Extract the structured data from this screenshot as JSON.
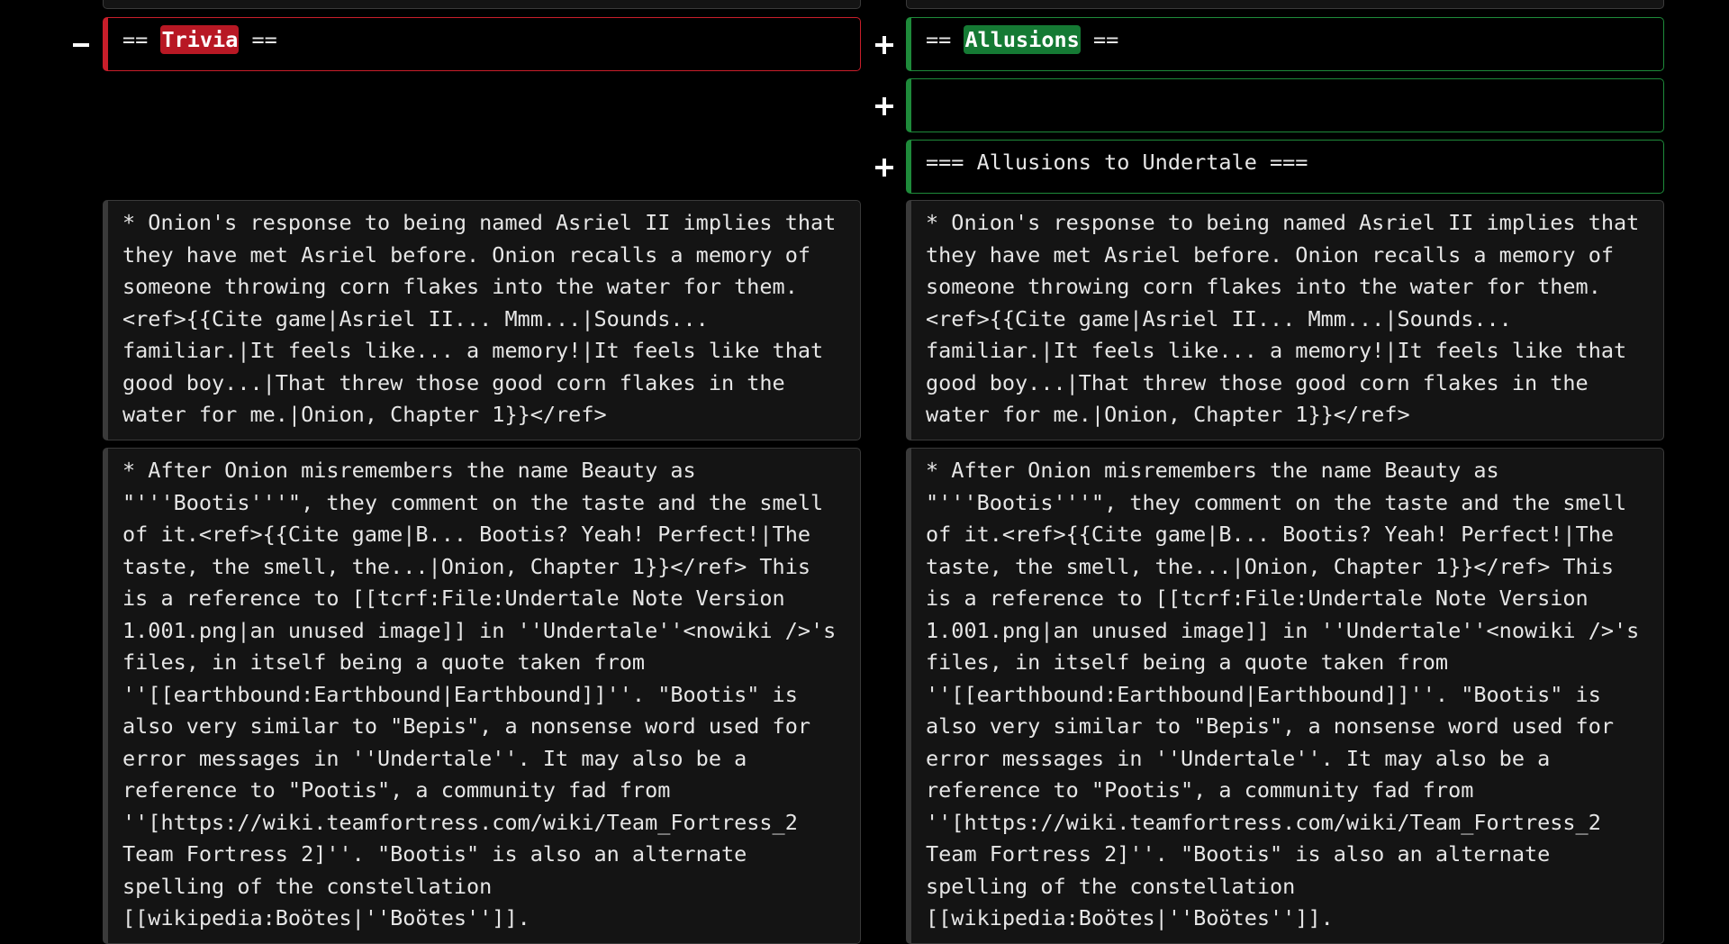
{
  "diff": {
    "removed_heading": {
      "prefix": "== ",
      "word": "Trivia",
      "suffix": " =="
    },
    "added_heading": {
      "prefix": "== ",
      "word": "Allusions",
      "suffix": " =="
    },
    "added_blank": "",
    "added_subheading": "=== Allusions to Undertale ===",
    "paragraph_1": "* Onion's response to being named Asriel II implies that they have met Asriel before. Onion recalls a memory of someone throwing corn flakes into the water for them.<ref>{{Cite game|Asriel II... Mmm...|Sounds... familiar.|It feels like... a memory!|It feels like that good boy...|That threw those good corn flakes in the water for me.|Onion, Chapter 1}}</ref>",
    "paragraph_2": "* After Onion misremembers the name Beauty as \"'''Bootis'''\", they comment on the taste and the smell of it.<ref>{{Cite game|B... Bootis? Yeah! Perfect!|The taste, the smell, the...|Onion, Chapter 1}}</ref> This is a reference to [[tcrf:File:Undertale Note Version 1.001.png|an unused image]] in ''Undertale''<nowiki />'s files, in itself being a quote taken from ''[[earthbound:Earthbound|Earthbound]]''. \"Bootis\" is also very similar to \"Bepis\", a nonsense word used for error messages in ''Undertale''. It may also be a reference to \"Pootis\", a community fad from ''[https://wiki.teamfortress.com/wiki/Team_Fortress_2 Team Fortress 2]''. \"Bootis\" is also an alternate spelling of the constellation [[wikipedia:Boötes|''Boötes'']]."
  },
  "colors": {
    "removed": "#c81e2a",
    "added": "#1e8a3a",
    "context_bg": "#141414",
    "page_bg": "#000000"
  },
  "icons": {
    "removed_marker": "minus-icon",
    "added_marker": "plus-icon"
  }
}
